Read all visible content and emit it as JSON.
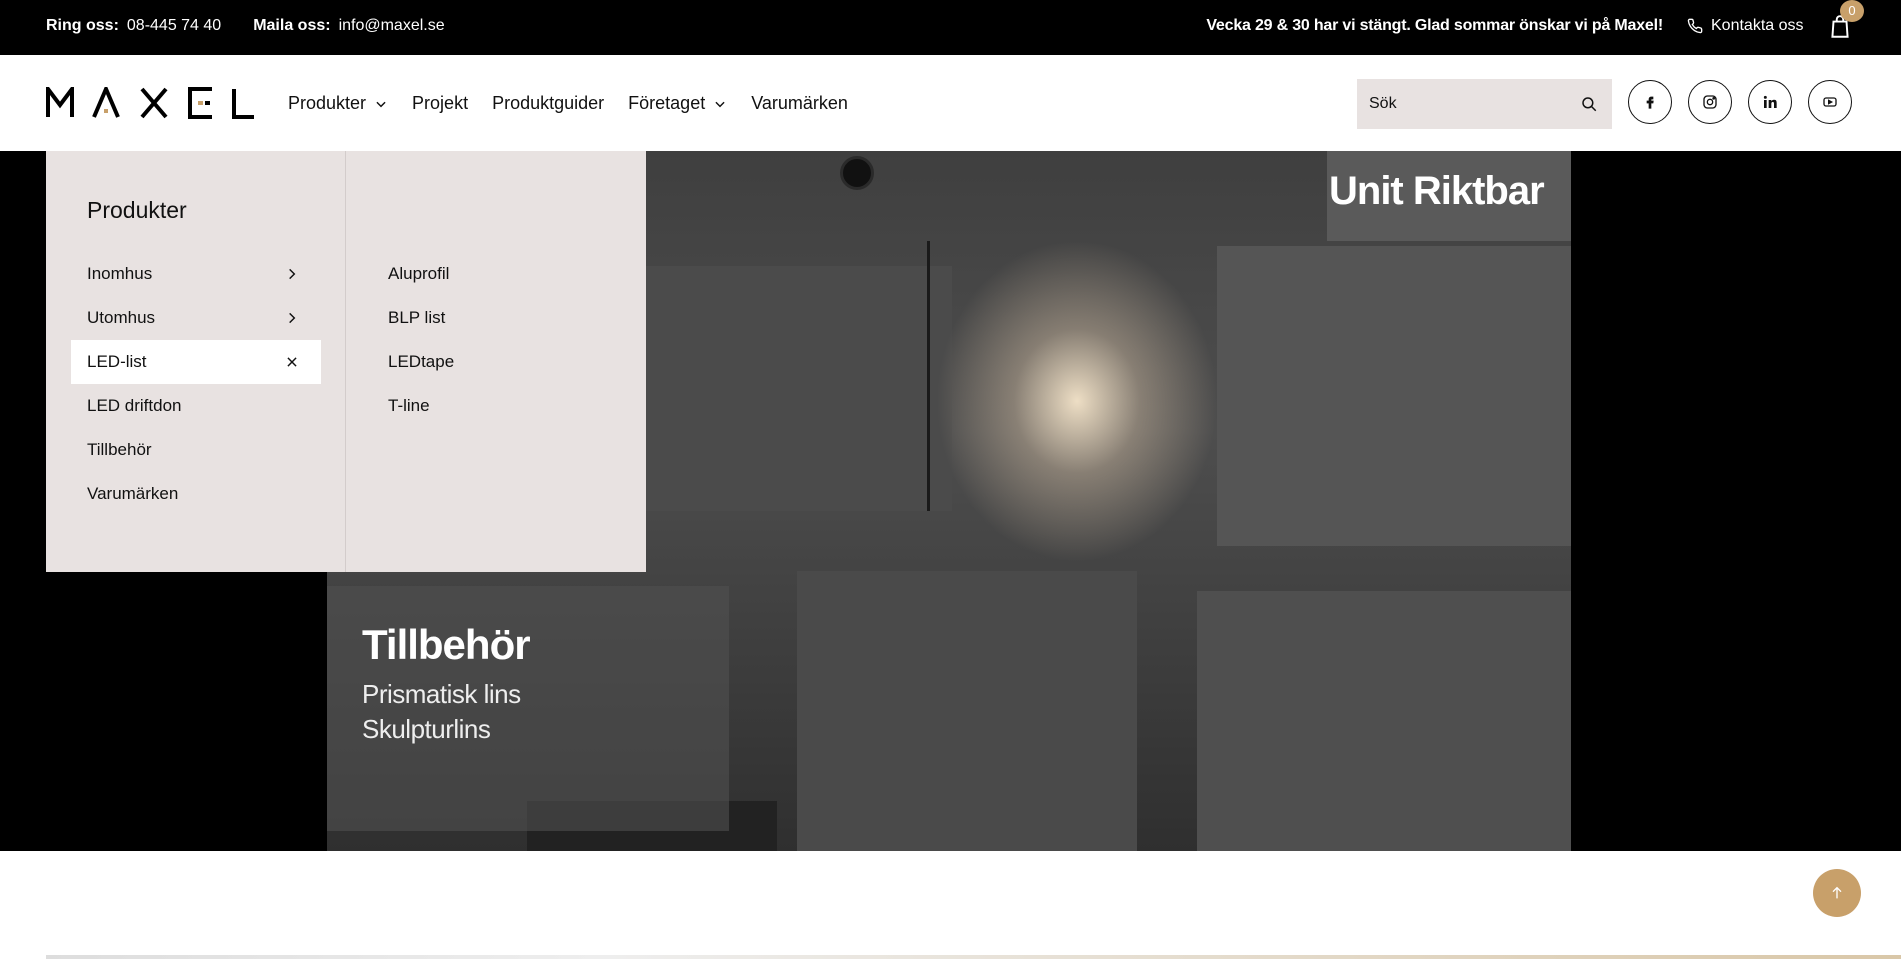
{
  "topbar": {
    "phone_label": "Ring oss:",
    "phone_value": "08-445 74 40",
    "email_label": "Maila oss:",
    "email_value": "info@maxel.se",
    "notice": "Vecka 29 & 30 har vi stängt. Glad sommar önskar vi på Maxel!",
    "contact": "Kontakta oss",
    "cart_count": "0"
  },
  "header": {
    "logo": "MAXEL",
    "nav": [
      {
        "label": "Produkter",
        "dropdown": true
      },
      {
        "label": "Projekt",
        "dropdown": false
      },
      {
        "label": "Produktguider",
        "dropdown": false
      },
      {
        "label": "Företaget",
        "dropdown": true
      },
      {
        "label": "Varumärken",
        "dropdown": false
      }
    ],
    "search_placeholder": "Sök",
    "social": [
      "facebook-icon",
      "instagram-icon",
      "linkedin-icon",
      "youtube-icon"
    ]
  },
  "mega": {
    "title": "Produkter",
    "categories": [
      {
        "label": "Inomhus",
        "icon": "chevron-right-icon"
      },
      {
        "label": "Utomhus",
        "icon": "chevron-right-icon"
      },
      {
        "label": "LED-list",
        "icon": "close-icon",
        "active": true
      },
      {
        "label": "LED driftdon"
      },
      {
        "label": "Tillbehör"
      },
      {
        "label": "Varumärken"
      }
    ],
    "subcategories": [
      "Aluprofil",
      "BLP list",
      "LEDtape",
      "T-line"
    ]
  },
  "hero": {
    "title": "Unit Riktbar",
    "accessory_title": "Tillbehör",
    "accessory_items": [
      "Prismatisk lins",
      "Skulpturlins"
    ]
  },
  "colors": {
    "accent": "#c8a06a",
    "topbar_bg": "#000000",
    "menu_bg": "#e8e2e1"
  }
}
